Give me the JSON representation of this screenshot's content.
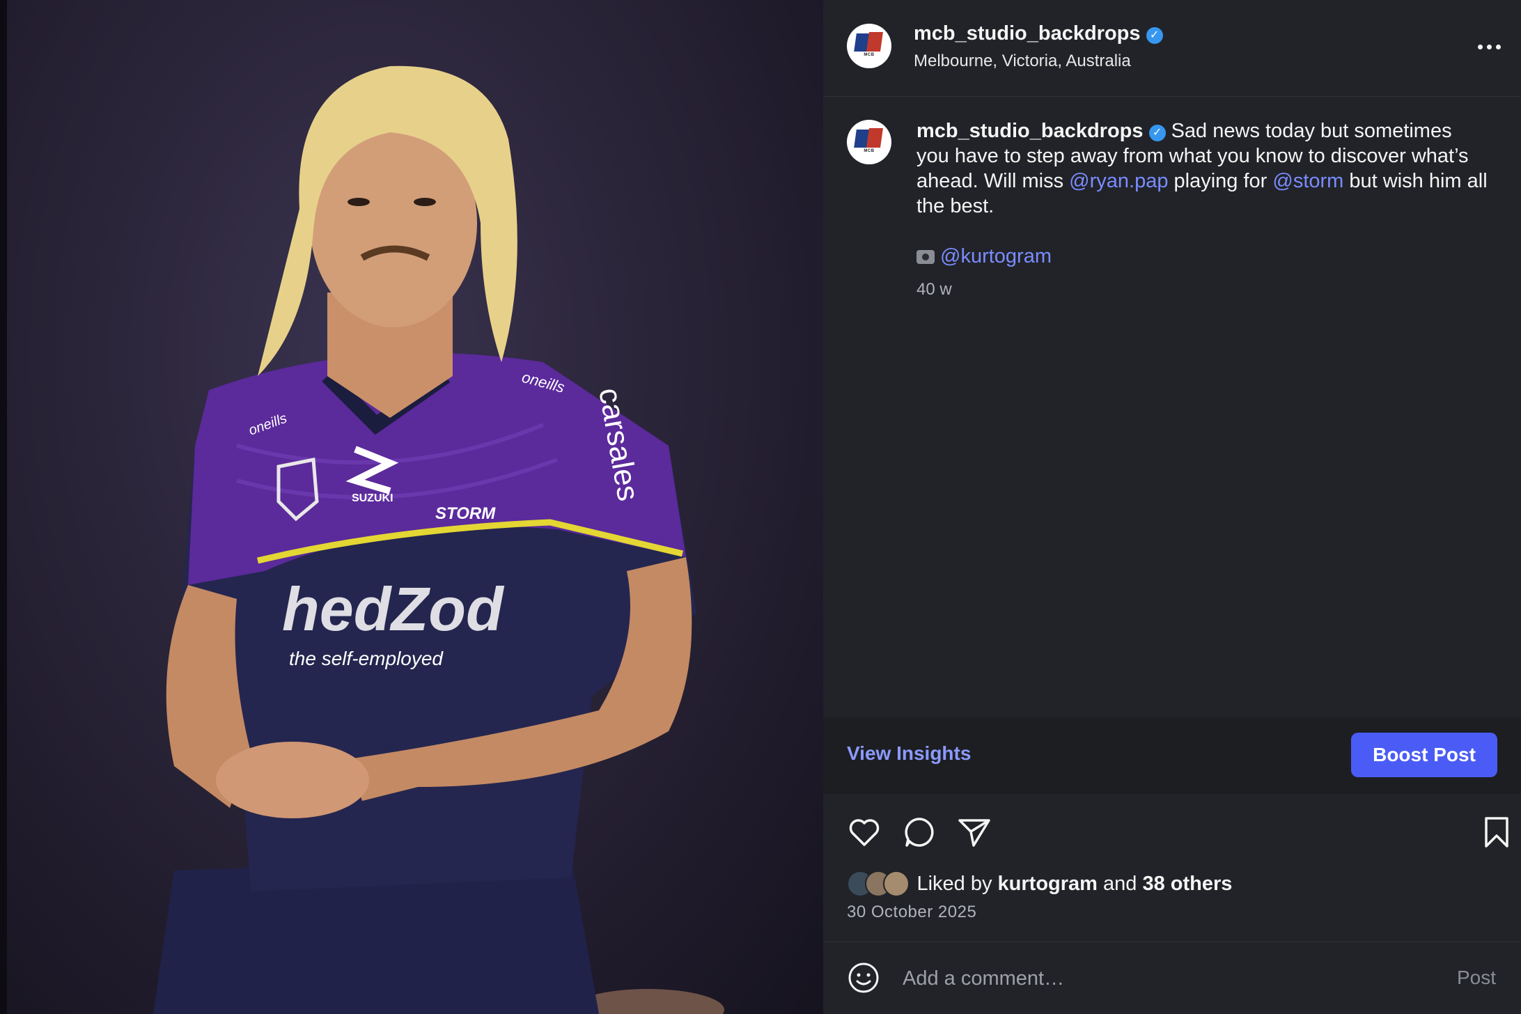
{
  "post": {
    "username": "mcb_studio_backdrops",
    "verified_mark": "✓",
    "location": "Melbourne, Victoria, Australia",
    "avatar_text": "MCB",
    "caption": {
      "username": "mcb_studio_backdrops",
      "text_1": " Sad news today but sometimes you have to step away from what you know to discover what’s ahead. Will miss ",
      "mention_1": "@ryan.pap",
      "text_2": " playing for ",
      "mention_2": "@storm",
      "text_3": " but wish him all the best."
    },
    "credit_mention": "@kurtogram",
    "age": "40 w"
  },
  "photo": {
    "jersey_brands": [
      "oneills",
      "SUZUKI",
      "STORM",
      "carsales",
      "the self-employed"
    ]
  },
  "insights": {
    "view_label": "View Insights",
    "boost_label": "Boost Post"
  },
  "actions": {
    "icons": [
      "heart-icon",
      "comment-icon",
      "share-icon",
      "bookmark-icon"
    ]
  },
  "likes": {
    "prefix": "Liked by ",
    "user": "kurtogram",
    "middle": " and ",
    "others": "38 others"
  },
  "date": "30 October 2025",
  "comment": {
    "placeholder": "Add a comment…",
    "post_label": "Post"
  },
  "colors": {
    "panel_bg": "#212328",
    "mention": "#7b8cff",
    "boost": "#4a5cf5",
    "verified": "#3797f0"
  }
}
